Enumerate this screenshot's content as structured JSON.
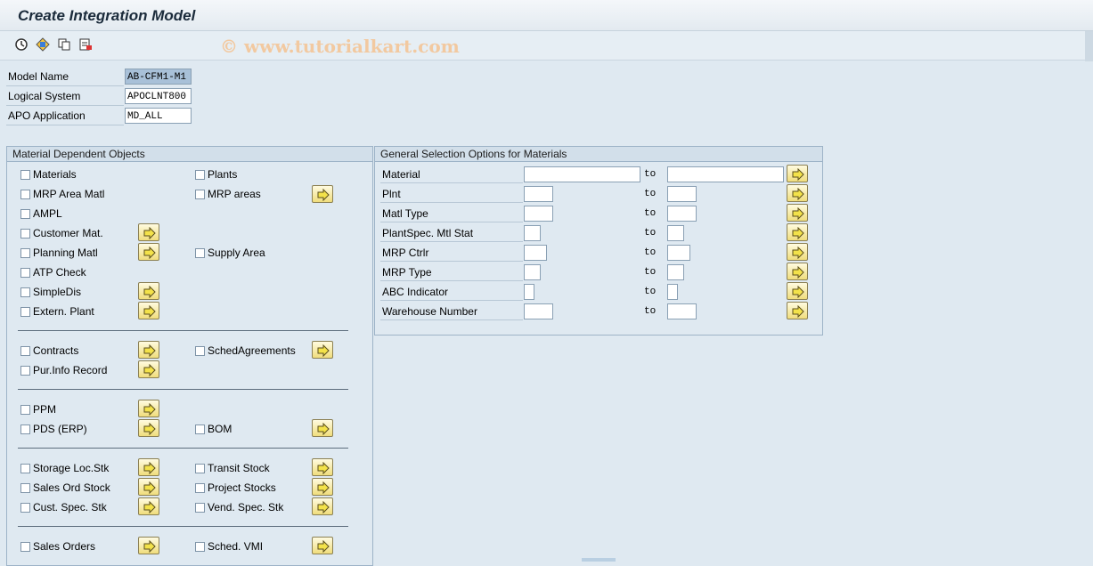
{
  "title": "Create Integration Model",
  "watermark": "© www.tutorialkart.com",
  "toolbar": {
    "icons": [
      "execute-icon",
      "variant-icon",
      "copy-icon",
      "delete-icon"
    ]
  },
  "header_fields": {
    "model_name": {
      "label": "Model Name",
      "value": "AB-CFM1-M1"
    },
    "logical_system": {
      "label": "Logical System",
      "value": "APOCLNT800"
    },
    "apo_application": {
      "label": "APO Application",
      "value": "MD_ALL"
    }
  },
  "mdo": {
    "title": "Material Dependent Objects",
    "items": {
      "materials": "Materials",
      "plants": "Plants",
      "mrp_area_matl": "MRP Area Matl",
      "mrp_areas": "MRP areas",
      "ampl": "AMPL",
      "customer_mat": "Customer Mat.",
      "planning_matl": "Planning Matl",
      "supply_area": "Supply Area",
      "atp_check": "ATP Check",
      "simpledis": "SimpleDis",
      "extern_plant": "Extern. Plant",
      "contracts": "Contracts",
      "schedagreements": "SchedAgreements",
      "pur_info_record": "Pur.Info Record",
      "ppm": "PPM",
      "pds_erp": "PDS (ERP)",
      "bom": "BOM",
      "storage_loc_stk": "Storage Loc.Stk",
      "transit_stock": "Transit Stock",
      "sales_ord_stock": "Sales Ord Stock",
      "project_stocks": "Project Stocks",
      "cust_spec_stk": "Cust. Spec. Stk",
      "vend_spec_stk": "Vend. Spec. Stk",
      "sales_orders": "Sales Orders",
      "sched_vmi": "Sched. VMI"
    }
  },
  "gso": {
    "title": "General Selection Options for Materials",
    "to_label": "to",
    "rows": {
      "material": {
        "label": "Material",
        "from": "",
        "to": ""
      },
      "plnt": {
        "label": "Plnt",
        "from": "",
        "to": ""
      },
      "matl_type": {
        "label": "Matl Type",
        "from": "",
        "to": ""
      },
      "plantspec_mtl_stat": {
        "label": "PlantSpec. Mtl Stat",
        "from": "",
        "to": ""
      },
      "mrp_ctrlr": {
        "label": "MRP Ctrlr",
        "from": "",
        "to": ""
      },
      "mrp_type": {
        "label": "MRP Type",
        "from": "",
        "to": ""
      },
      "abc_indicator": {
        "label": "ABC Indicator",
        "from": "",
        "to": ""
      },
      "warehouse_number": {
        "label": "Warehouse Number",
        "from": "",
        "to": ""
      }
    }
  }
}
